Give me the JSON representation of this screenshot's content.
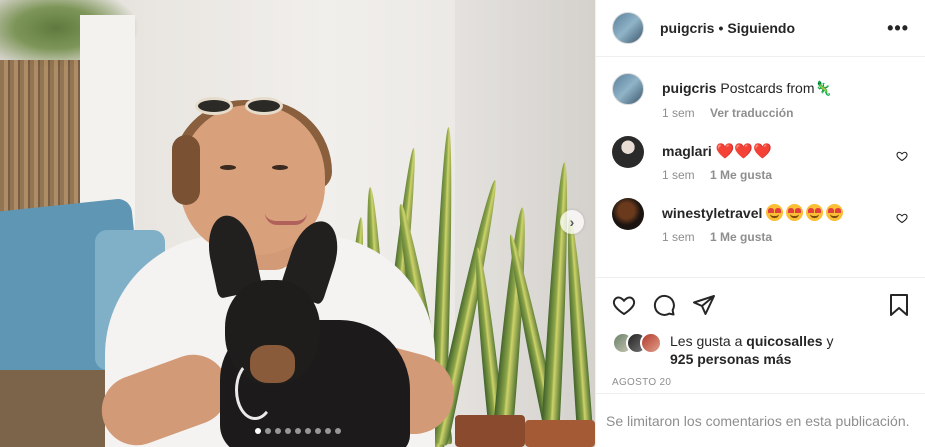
{
  "post": {
    "username": "puigcris",
    "separator": "•",
    "follow_status": "Siguiendo",
    "more_label": "•••",
    "caption_text": "Postcards from",
    "caption_emoji": "🦎",
    "caption_time": "1 sem",
    "translate_label": "Ver traducción"
  },
  "comments": [
    {
      "username": "maglari",
      "emoji": "❤️❤️❤️",
      "time": "1 sem",
      "likes": "1 Me gusta"
    },
    {
      "username": "winestyletravel",
      "emoji": "😍😍😍😍",
      "time": "1 sem",
      "likes": "1 Me gusta"
    }
  ],
  "likes": {
    "prefix": "Les gusta a",
    "user": "quicosalles",
    "conj": "y",
    "others": "925 personas más"
  },
  "date": "AGOSTO 20",
  "footer_note": "Se limitaron los comentarios en esta publicación.",
  "carousel": {
    "total": 9,
    "current": 1
  },
  "icons": {
    "like": "heart-icon",
    "comment": "comment-icon",
    "share": "paper-plane-icon",
    "save": "bookmark-icon",
    "next": "chevron-right-icon"
  },
  "colors": {
    "text": "#262626",
    "secondary": "#8e8e8e",
    "border": "#efefef"
  }
}
